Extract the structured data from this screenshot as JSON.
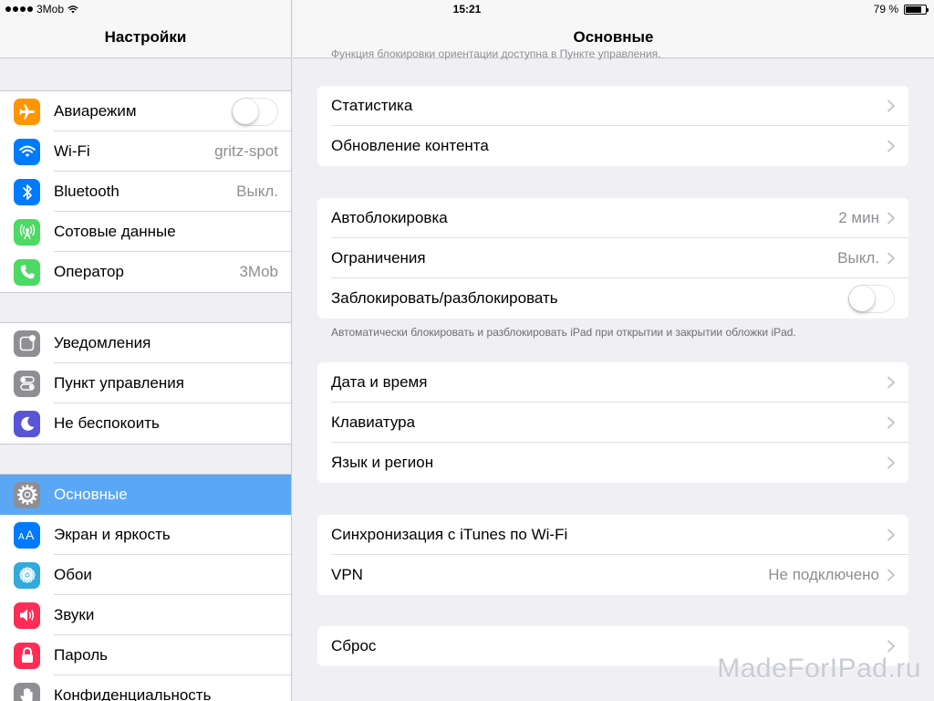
{
  "status": {
    "carrier": "3Mob",
    "time": "15:21",
    "battery": "79 %",
    "battery_level": 0.79
  },
  "sidebar": {
    "title": "Настройки",
    "groups": [
      [
        {
          "label": "Авиарежим",
          "icon": "airplane-icon",
          "color": "#ff9500",
          "toggle": false
        },
        {
          "label": "Wi-Fi",
          "value": "gritz-spot",
          "icon": "wifi-icon",
          "color": "#007aff"
        },
        {
          "label": "Bluetooth",
          "value": "Выкл.",
          "icon": "bluetooth-icon",
          "color": "#007aff"
        },
        {
          "label": "Сотовые данные",
          "icon": "cellular-icon",
          "color": "#4cd964"
        },
        {
          "label": "Оператор",
          "value": "3Mob",
          "icon": "phone-icon",
          "color": "#4cd964"
        }
      ],
      [
        {
          "label": "Уведомления",
          "icon": "notifications-icon",
          "color": "#8e8e93"
        },
        {
          "label": "Пункт управления",
          "icon": "control-center-icon",
          "color": "#8e8e93"
        },
        {
          "label": "Не беспокоить",
          "icon": "moon-icon",
          "color": "#5856d6"
        }
      ],
      [
        {
          "label": "Основные",
          "icon": "gear-icon",
          "color": "#8e8e93",
          "active": true
        },
        {
          "label": "Экран и яркость",
          "icon": "display-brightness-icon",
          "color": "#007aff"
        },
        {
          "label": "Обои",
          "icon": "wallpaper-icon",
          "color": "#34aadc"
        },
        {
          "label": "Звуки",
          "icon": "sounds-icon",
          "color": "#ff2d55"
        },
        {
          "label": "Пароль",
          "icon": "lock-icon",
          "color": "#ff2d55"
        },
        {
          "label": "Конфиденциальность",
          "icon": "hand-icon",
          "color": "#8e8e93"
        }
      ]
    ]
  },
  "main": {
    "title": "Основные",
    "cut_text": "Функция блокировки ориентации доступна в Пункте управления.",
    "groups": [
      {
        "rows": [
          {
            "label": "Статистика"
          },
          {
            "label": "Обновление контента"
          }
        ]
      },
      {
        "rows": [
          {
            "label": "Автоблокировка",
            "value": "2 мин"
          },
          {
            "label": "Ограничения",
            "value": "Выкл."
          },
          {
            "label": "Заблокировать/разблокировать",
            "toggle": false
          }
        ],
        "footer": "Автоматически блокировать и разблокировать iPad при открытии и закрытии обложки iPad."
      },
      {
        "rows": [
          {
            "label": "Дата и время"
          },
          {
            "label": "Клавиатура"
          },
          {
            "label": "Язык и регион"
          }
        ]
      },
      {
        "rows": [
          {
            "label": "Синхронизация с iTunes по Wi-Fi"
          },
          {
            "label": "VPN",
            "value": "Не подключено"
          }
        ]
      },
      {
        "rows": [
          {
            "label": "Сброс"
          }
        ]
      }
    ]
  },
  "watermark": "MadeForIPad.ru",
  "colors": {
    "selection": "#5aa7f5",
    "chevron": "#c7c7cc",
    "background": "#efeff4"
  }
}
